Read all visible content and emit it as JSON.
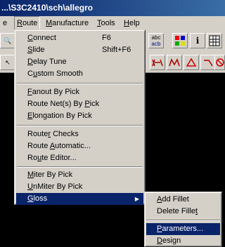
{
  "title": "...\\S3C2410\\sch\\allegro",
  "menubar": [
    {
      "label": "Route",
      "accel": "R",
      "rest": "oute"
    },
    {
      "label": "Manufacture",
      "accel": "M",
      "rest": "anufacture"
    },
    {
      "label": "Tools",
      "accel": "T",
      "rest": "ools"
    },
    {
      "label": "Help",
      "accel": "H",
      "rest": "elp"
    }
  ],
  "menubar_partial_left": "e",
  "toolbar": {
    "abc_button": "abc\nacb"
  },
  "route_menu": {
    "items": [
      {
        "a": "C",
        "r": "onnect",
        "shortcut": "F6"
      },
      {
        "a": "S",
        "r": "lide",
        "shortcut": "Shift+F6"
      },
      {
        "a": "D",
        "r": "elay Tune",
        "shortcut": ""
      },
      {
        "p": "C",
        "a": "u",
        "r": "stom Smooth",
        "shortcut": ""
      },
      {
        "a": "F",
        "r": "anout By Pick",
        "shortcut": ""
      },
      {
        "p": "Route Net(s) By ",
        "a": "P",
        "r": "ick",
        "shortcut": ""
      },
      {
        "a": "E",
        "r": "longation By Pick",
        "shortcut": ""
      },
      {
        "p": "Route",
        "a": "r",
        "r": " Checks",
        "shortcut": ""
      },
      {
        "p": "Route ",
        "a": "A",
        "r": "utomatic...",
        "shortcut": ""
      },
      {
        "p": "Ro",
        "a": "u",
        "r": "te Editor...",
        "shortcut": ""
      },
      {
        "a": "M",
        "r": "iter By Pick",
        "shortcut": ""
      },
      {
        "a": "U",
        "r": "nMiter By Pick",
        "shortcut": ""
      },
      {
        "a": "G",
        "r": "loss",
        "shortcut": ""
      }
    ]
  },
  "gloss_menu": {
    "items": [
      {
        "a": "A",
        "r": "dd Fillet"
      },
      {
        "p": "Delete Fille",
        "a": "t",
        "r": ""
      },
      {
        "a": "P",
        "r": "arameters..."
      },
      {
        "a": "D",
        "r": "esign"
      }
    ]
  }
}
